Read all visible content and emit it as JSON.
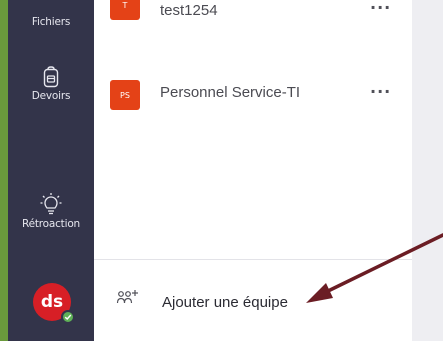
{
  "rail": {
    "items": [
      {
        "label": "Fichiers",
        "icon": "file-icon"
      },
      {
        "label": "Devoirs",
        "icon": "backpack-icon"
      },
      {
        "label": "Rétroaction",
        "icon": "lightbulb-icon"
      }
    ],
    "avatar_initials": "ds",
    "accent": "#6a9a3c"
  },
  "teams": [
    {
      "name": "test1254",
      "tile_initials": "T",
      "more_label": "···"
    },
    {
      "name": "Personnel Service-TI",
      "tile_initials": "PS",
      "more_label": "···"
    }
  ],
  "add_team": {
    "label": "Ajouter une équipe",
    "icon": "add-team-icon"
  },
  "colors": {
    "rail_bg": "#33344a",
    "tile_bg": "#e44217",
    "avatar_bg": "#d71f26",
    "presence": "#5fb157",
    "arrow": "#6b1d24"
  }
}
